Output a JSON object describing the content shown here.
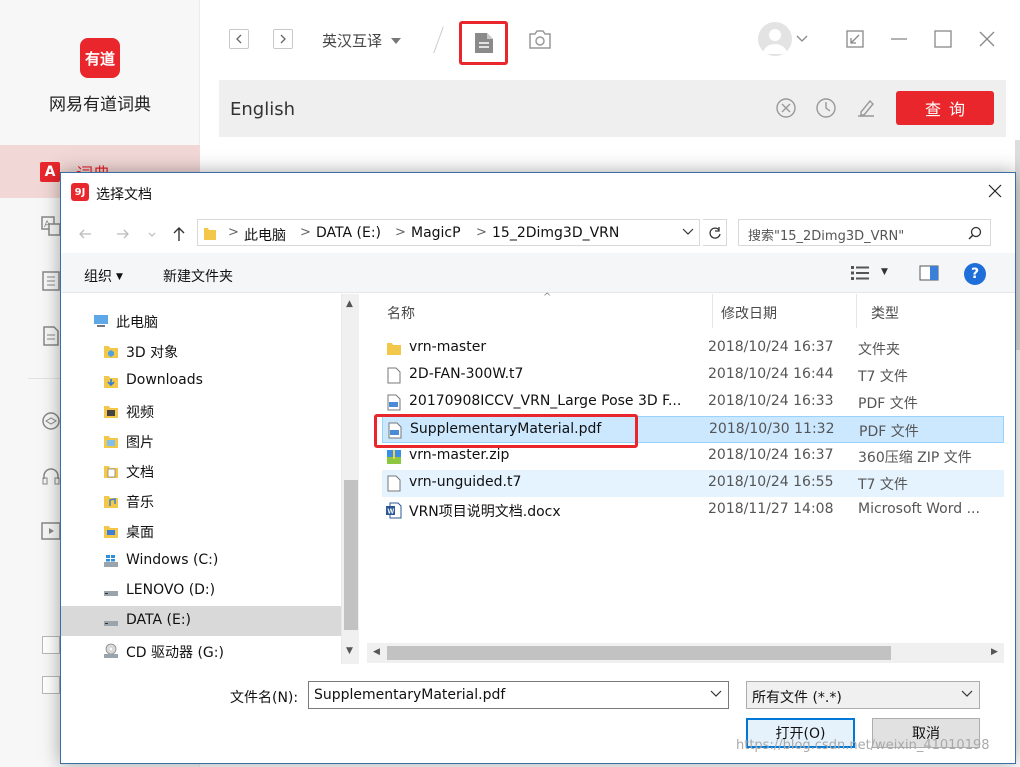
{
  "app": {
    "logo_text": "有道",
    "name": "网易有道词典",
    "sidebar_active_label": "词典",
    "language_select": "英汉互译",
    "search_query": "English",
    "query_button": "查询"
  },
  "dialog": {
    "title": "选择文档",
    "breadcrumb": [
      "此电脑",
      "DATA (E:)",
      "MagicP",
      "15_2Dimg3D_VRN"
    ],
    "search_placeholder": "搜索\"15_2Dimg3D_VRN\"",
    "toolbar": {
      "organize": "组织",
      "new_folder": "新建文件夹",
      "help": "?"
    },
    "nav_items": [
      {
        "label": "此电脑",
        "icon": "computer-icon"
      },
      {
        "label": "3D 对象",
        "icon": "3d-objects-icon"
      },
      {
        "label": "Downloads",
        "icon": "downloads-icon"
      },
      {
        "label": "视频",
        "icon": "videos-icon"
      },
      {
        "label": "图片",
        "icon": "pictures-icon"
      },
      {
        "label": "文档",
        "icon": "documents-icon"
      },
      {
        "label": "音乐",
        "icon": "music-icon"
      },
      {
        "label": "桌面",
        "icon": "desktop-icon"
      },
      {
        "label": "Windows (C:)",
        "icon": "drive-icon"
      },
      {
        "label": "LENOVO (D:)",
        "icon": "drive-icon"
      },
      {
        "label": "DATA (E:)",
        "icon": "drive-icon"
      },
      {
        "label": "CD 驱动器 (G:)",
        "icon": "cd-drive-icon"
      }
    ],
    "columns": {
      "name": "名称",
      "date": "修改日期",
      "type": "类型"
    },
    "files": [
      {
        "name": "vrn-master",
        "date": "2018/10/24 16:37",
        "type": "文件夹",
        "icon": "folder-icon"
      },
      {
        "name": "2D-FAN-300W.t7",
        "date": "2018/10/24 16:44",
        "type": "T7 文件",
        "icon": "file-icon"
      },
      {
        "name": "20170908ICCV_VRN_Large Pose 3D F...",
        "date": "2018/10/24 16:33",
        "type": "PDF 文件",
        "icon": "pdf-icon"
      },
      {
        "name": "SupplementaryMaterial.pdf",
        "date": "2018/10/30 11:32",
        "type": "PDF 文件",
        "icon": "pdf-icon"
      },
      {
        "name": "vrn-master.zip",
        "date": "2018/10/24 16:37",
        "type": "360压缩 ZIP 文件",
        "icon": "zip-icon"
      },
      {
        "name": "vrn-unguided.t7",
        "date": "2018/10/24 16:55",
        "type": "T7 文件",
        "icon": "file-icon"
      },
      {
        "name": "VRN项目说明文档.docx",
        "date": "2018/11/27 14:08",
        "type": "Microsoft Word ...",
        "icon": "word-icon"
      }
    ],
    "filename_label": "文件名(N):",
    "filename_value": "SupplementaryMaterial.pdf",
    "filter_value": "所有文件 (*.*)",
    "open_button": "打开(O)",
    "cancel_button": "取消"
  },
  "watermark": "https://blog.csdn.net/weixin_41010198",
  "colors": {
    "brand_red": "#e8262c",
    "selection": "#cce8ff",
    "accent_blue": "#0078d7"
  }
}
